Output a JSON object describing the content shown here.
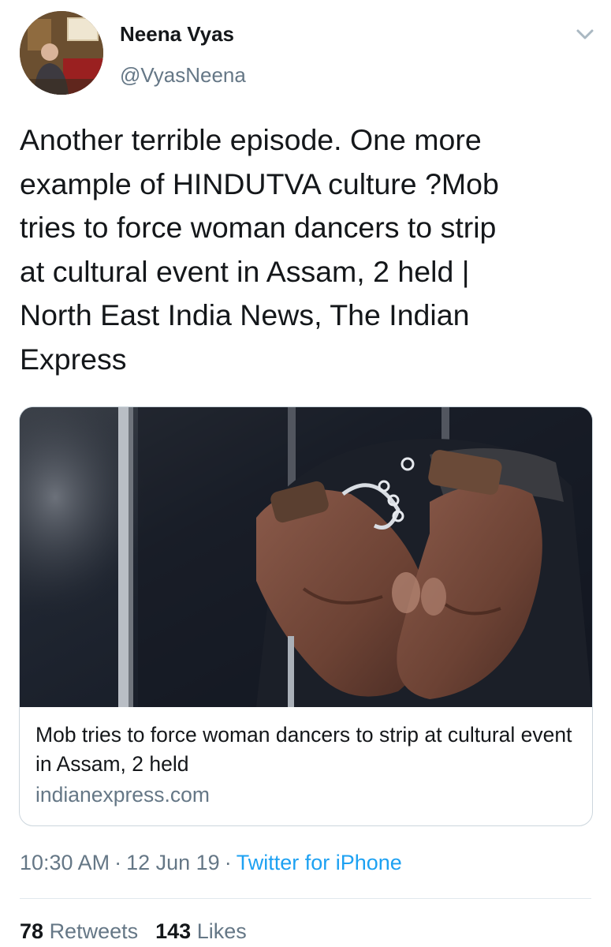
{
  "author": {
    "display_name": "Neena Vyas",
    "handle": "@VyasNeena",
    "avatar_icon": "user-avatar-photo",
    "menu_icon": "chevron-down-icon"
  },
  "tweet": {
    "text": "Another terrible episode. One more\nexample of HINDUTVA culture ?Mob\ntries to force woman dancers to strip\nat cultural event in Assam, 2 held |\nNorth East India News, The Indian\nExpress"
  },
  "card": {
    "image_icon": "handcuffed-hands-photo",
    "title": "Mob tries to force woman dancers to strip at cultural event in Assam, 2 held",
    "domain": "indianexpress.com"
  },
  "meta": {
    "time": "10:30 AM",
    "date": "12 Jun 19",
    "separator": "·",
    "source": "Twitter for iPhone"
  },
  "stats": {
    "retweets_count": "78",
    "retweets_label": "Retweets",
    "likes_count": "143",
    "likes_label": "Likes"
  },
  "colors": {
    "link": "#1da1f2",
    "secondary_text": "#657786",
    "primary_text": "#14171a",
    "border": "#ccd6dd"
  }
}
